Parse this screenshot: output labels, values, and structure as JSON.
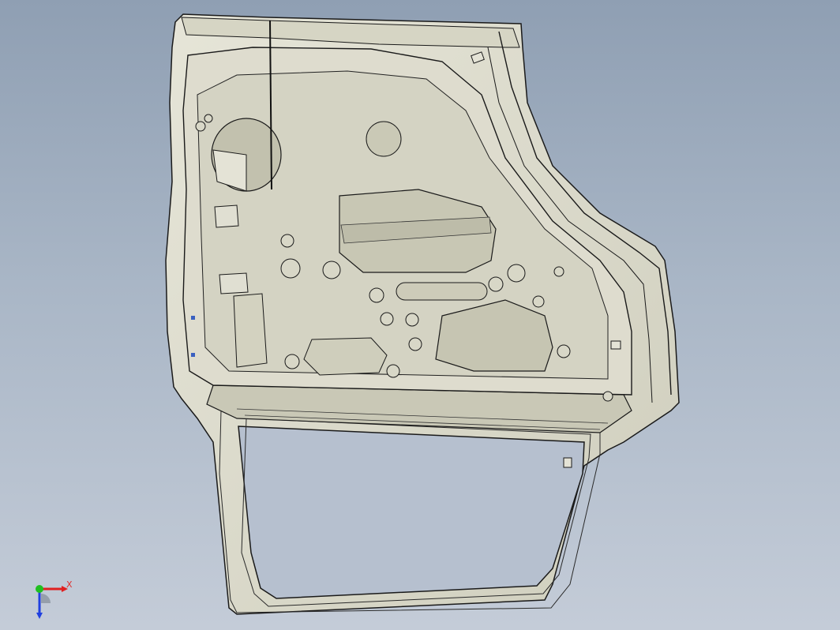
{
  "viewport": {
    "background_top": "#8f9fb3",
    "background_bottom": "#c4ccd8",
    "model_fill": "#d9d8c9",
    "model_shade": "#b9b8a6",
    "model_edge": "#1a1a1a"
  },
  "triad": {
    "x_label": "X",
    "x_color": "#e02020",
    "y_color": "#20c020",
    "z_color": "#2040e0"
  }
}
